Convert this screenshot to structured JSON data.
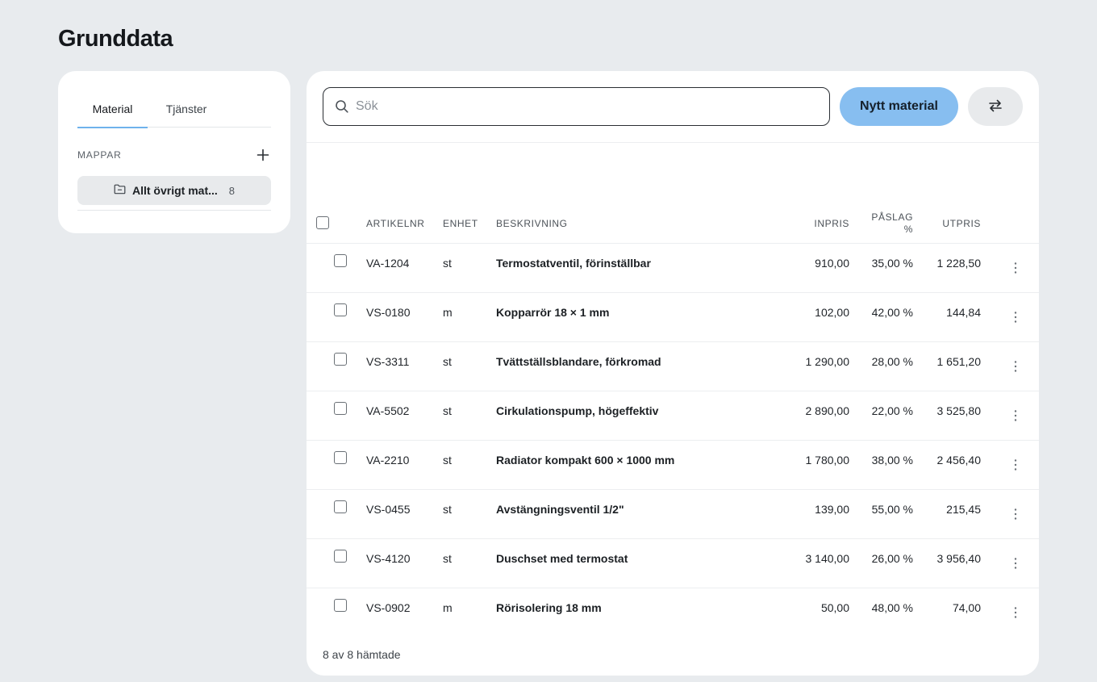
{
  "page": {
    "title": "Grunddata"
  },
  "tabs": [
    {
      "label": "Material",
      "active": true
    },
    {
      "label": "Tjänster",
      "active": false
    }
  ],
  "folders": {
    "label": "MAPPAR",
    "items": [
      {
        "name": "Allt övrigt mat...",
        "count": "8"
      }
    ]
  },
  "toolbar": {
    "search_placeholder": "Sök",
    "search_value": "",
    "new_button_label": "Nytt material"
  },
  "table": {
    "columns": {
      "article": "ARTIKELNR",
      "unit": "ENHET",
      "description": "BESKRIVNING",
      "inprice": "INPRIS",
      "markup_line1": "PÅSLAG",
      "markup_line2": "%",
      "outprice": "UTPRIS"
    },
    "rows": [
      {
        "article": "VA-1204",
        "unit": "st",
        "description": "Termostatventil, förinställbar",
        "inprice": "910,00",
        "markup": "35,00 %",
        "outprice": "1 228,50"
      },
      {
        "article": "VS-0180",
        "unit": "m",
        "description": "Kopparrör 18 × 1 mm",
        "inprice": "102,00",
        "markup": "42,00 %",
        "outprice": "144,84"
      },
      {
        "article": "VS-3311",
        "unit": "st",
        "description": "Tvättställsblandare, förkromad",
        "inprice": "1 290,00",
        "markup": "28,00 %",
        "outprice": "1 651,20"
      },
      {
        "article": "VA-5502",
        "unit": "st",
        "description": "Cirkulationspump, högeffektiv",
        "inprice": "2 890,00",
        "markup": "22,00 %",
        "outprice": "3 525,80"
      },
      {
        "article": "VA-2210",
        "unit": "st",
        "description": "Radiator kompakt 600 × 1000 mm",
        "inprice": "1 780,00",
        "markup": "38,00 %",
        "outprice": "2 456,40"
      },
      {
        "article": "VS-0455",
        "unit": "st",
        "description": "Avstängningsventil 1/2\"",
        "inprice": "139,00",
        "markup": "55,00 %",
        "outprice": "215,45"
      },
      {
        "article": "VS-4120",
        "unit": "st",
        "description": "Duschset med termostat",
        "inprice": "3 140,00",
        "markup": "26,00 %",
        "outprice": "3 956,40"
      },
      {
        "article": "VS-0902",
        "unit": "m",
        "description": "Rörisolering 18 mm",
        "inprice": "50,00",
        "markup": "48,00 %",
        "outprice": "74,00"
      }
    ]
  },
  "footer": {
    "status": "8 av 8 hämtade"
  },
  "colors": {
    "background": "#e8ebee",
    "accent": "#87bef0",
    "tab_underline": "#6fb2ec"
  }
}
